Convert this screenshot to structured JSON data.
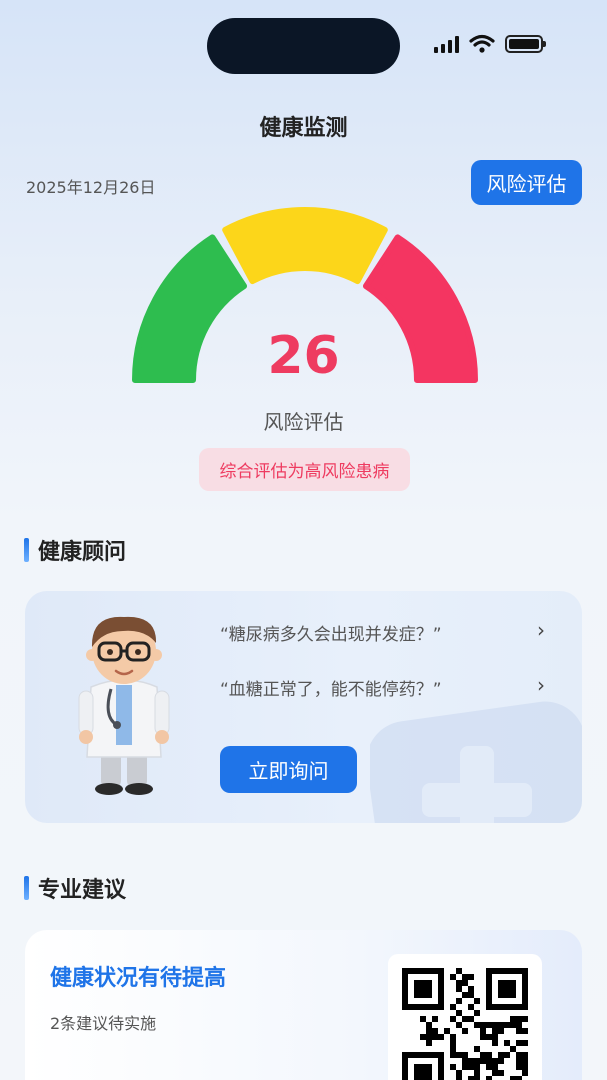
{
  "page": {
    "title": "健康监测",
    "date": "2025年12月26日",
    "risk_button": "风险评估"
  },
  "gauge": {
    "score": "26",
    "label": "风险评估",
    "conclusion": "综合评估为高风险患病",
    "colors": {
      "low": "#2ebd4f",
      "mid": "#fcd61a",
      "high": "#f43561"
    }
  },
  "advisor": {
    "section_title": "健康顾问",
    "questions": [
      "“糖尿病多久会出现并发症？”",
      "“血糖正常了，能不能停药？”"
    ],
    "ask_button": "立即询问"
  },
  "advice": {
    "section_title": "专业建议",
    "title": "健康状况有待提高",
    "subtitle": "2条建议待实施"
  },
  "colors": {
    "accent": "#1f74e8",
    "danger": "#ee3b60"
  },
  "icons": {
    "chevron": "chevron-right-icon",
    "doctor": "doctor-avatar",
    "qr": "qr-code"
  }
}
